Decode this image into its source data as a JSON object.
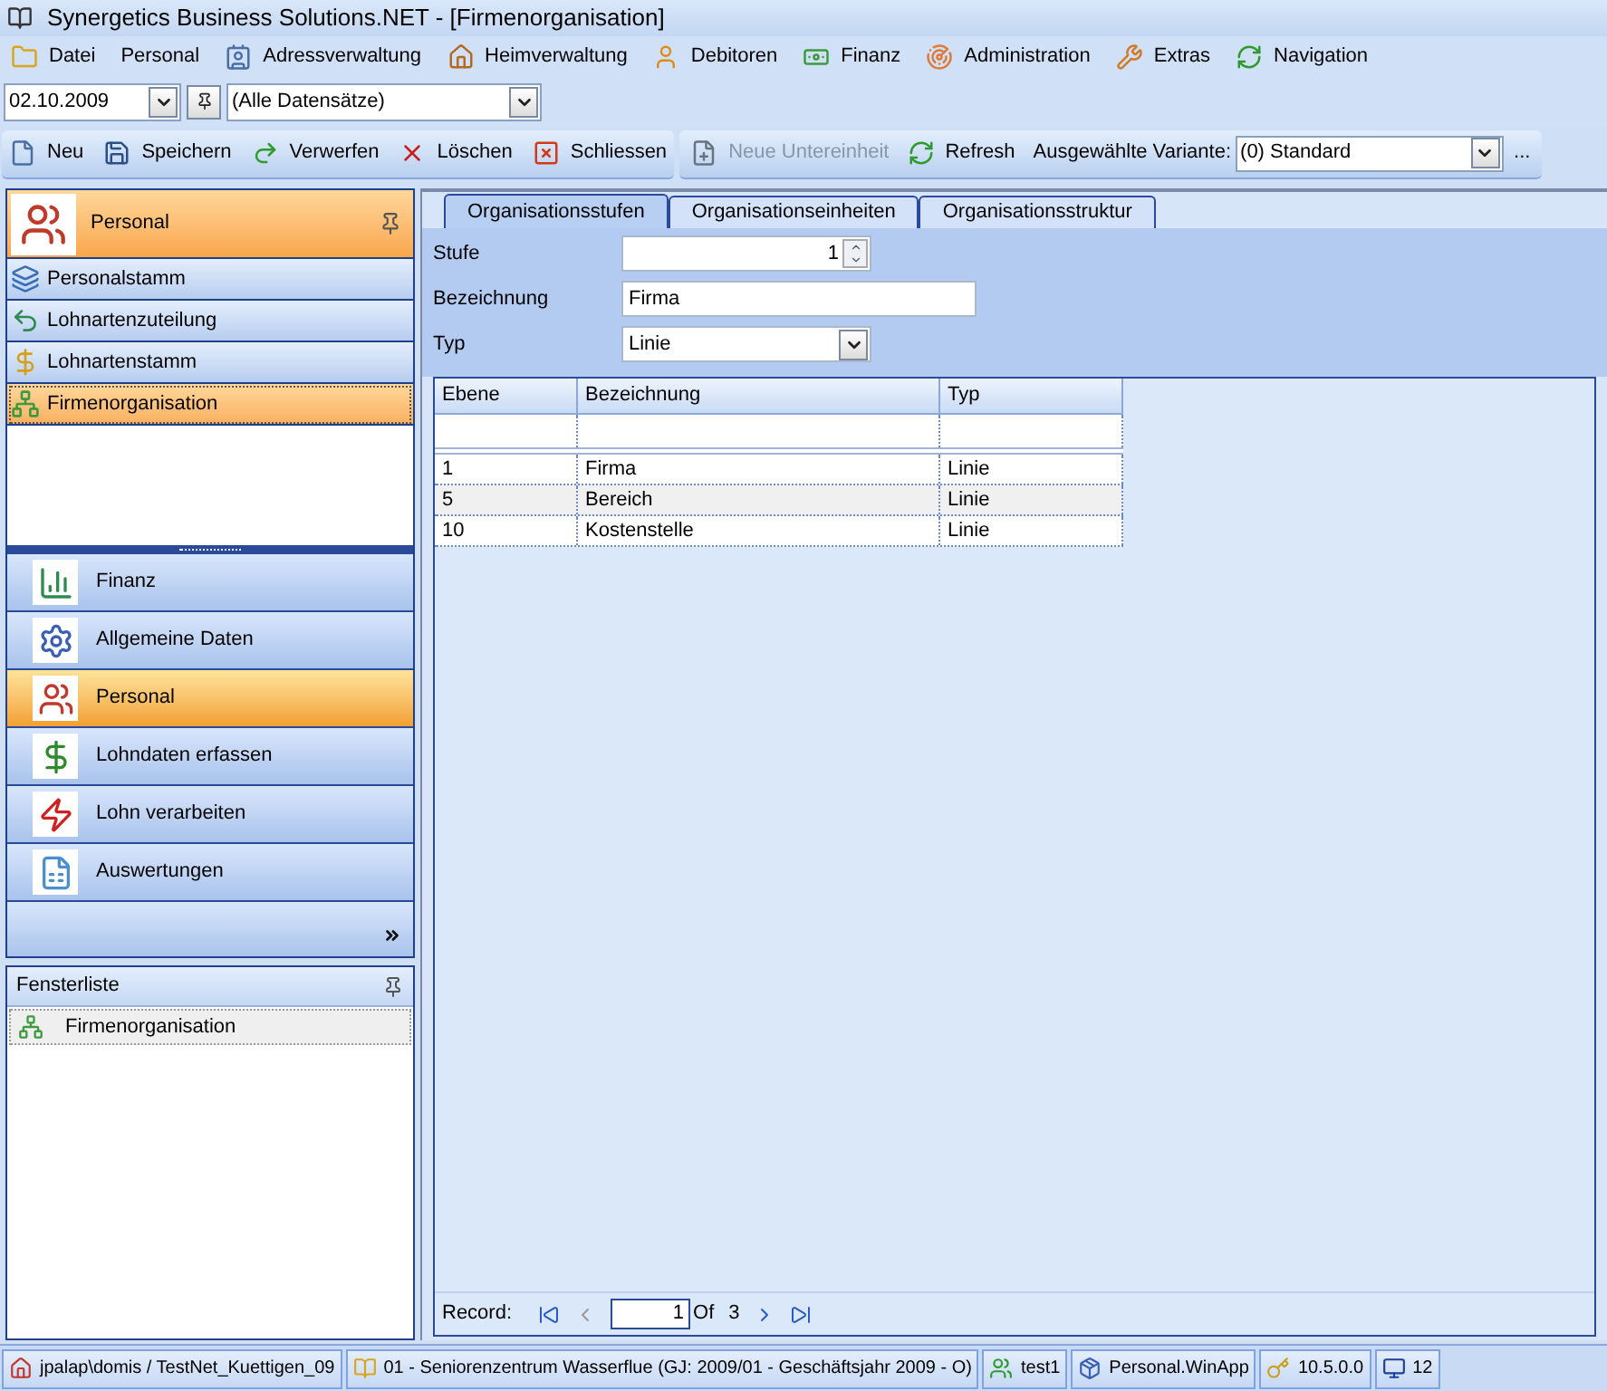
{
  "window": {
    "title": "Synergetics Business Solutions.NET - [Firmenorganisation]"
  },
  "menu": [
    {
      "label": "Datei"
    },
    {
      "label": "Personal"
    },
    {
      "label": "Adressverwaltung"
    },
    {
      "label": "Heimverwaltung"
    },
    {
      "label": "Debitoren"
    },
    {
      "label": "Finanz"
    },
    {
      "label": "Administration"
    },
    {
      "label": "Extras"
    },
    {
      "label": "Navigation"
    }
  ],
  "filter": {
    "date": "02.10.2009",
    "records": "(Alle Datensätze)"
  },
  "toolbar": [
    {
      "label": "Neu",
      "disabled": false
    },
    {
      "label": "Speichern",
      "disabled": false
    },
    {
      "label": "Verwerfen",
      "disabled": false
    },
    {
      "label": "Löschen",
      "disabled": false
    },
    {
      "label": "Schliessen",
      "disabled": false
    }
  ],
  "toolbar2": [
    {
      "label": "Neue Untereinheit",
      "disabled": true
    },
    {
      "label": "Refresh",
      "disabled": false
    }
  ],
  "variant": {
    "label": "Ausgewählte Variante:",
    "value": "(0) Standard",
    "more": "..."
  },
  "sidebar": {
    "header": "Personal",
    "items": [
      {
        "label": "Personalstamm",
        "selected": false
      },
      {
        "label": "Lohnartenzuteilung",
        "selected": false
      },
      {
        "label": "Lohnartenstamm",
        "selected": false
      },
      {
        "label": "Firmenorganisation",
        "selected": true
      }
    ]
  },
  "nav": [
    {
      "label": "Finanz",
      "selected": false
    },
    {
      "label": "Allgemeine Daten",
      "selected": false
    },
    {
      "label": "Personal",
      "selected": true
    },
    {
      "label": "Lohndaten erfassen",
      "selected": false
    },
    {
      "label": "Lohn verarbeiten",
      "selected": false
    },
    {
      "label": "Auswertungen",
      "selected": false
    }
  ],
  "window_list": {
    "title": "Fensterliste",
    "items": [
      {
        "label": "Firmenorganisation"
      }
    ]
  },
  "tabs": [
    {
      "label": "Organisationsstufen",
      "selected": true
    },
    {
      "label": "Organisationseinheiten",
      "selected": false
    },
    {
      "label": "Organisationsstruktur",
      "selected": false
    }
  ],
  "form": {
    "stufe_label": "Stufe",
    "stufe": "1",
    "bezeichnung_label": "Bezeichnung",
    "bezeichnung": "Firma",
    "typ_label": "Typ",
    "typ": "Linie"
  },
  "table": {
    "columns": [
      "Ebene",
      "Bezeichnung",
      "Typ"
    ],
    "rows": [
      [
        "1",
        "Firma",
        "Linie"
      ],
      [
        "5",
        "Bereich",
        "Linie"
      ],
      [
        "10",
        "Kostenstelle",
        "Linie"
      ]
    ]
  },
  "navigator": {
    "label": "Record:",
    "value": "1",
    "of": "Of",
    "total": "3"
  },
  "status_bar": [
    "jpalap\\domis / TestNet_Kuettigen_09",
    "01   - Seniorenzentrum Wasserflue (GJ: 2009/01 - Geschäftsjahr 2009 - O)",
    "test1",
    "Personal.WinApp",
    "10.5.0.0",
    "12"
  ]
}
